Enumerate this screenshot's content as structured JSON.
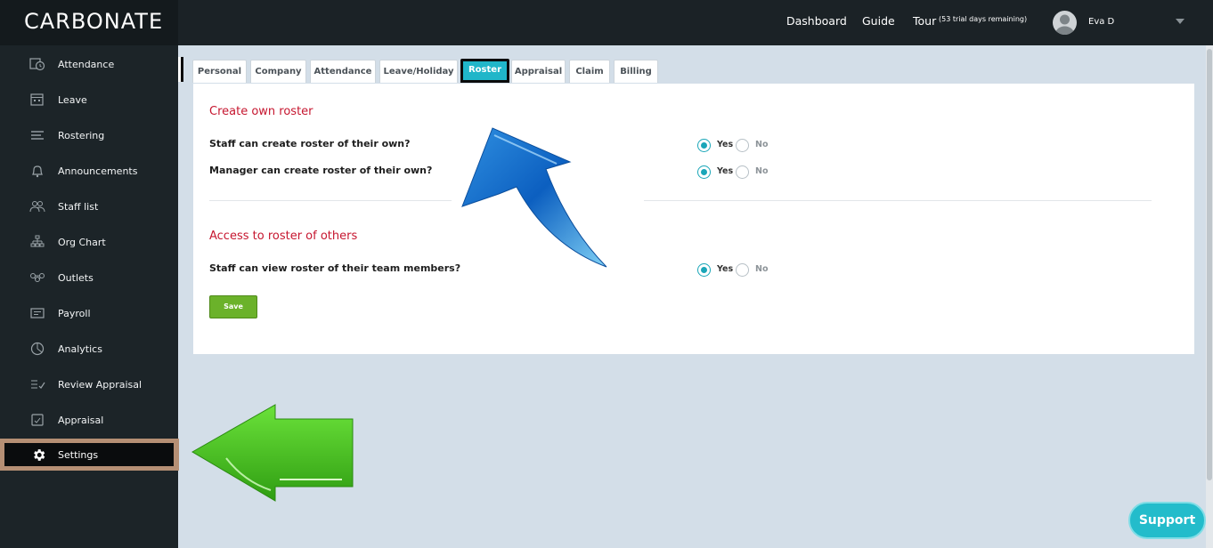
{
  "app": {
    "logo": "CARBONATE",
    "nav": {
      "dashboard": "Dashboard",
      "guide": "Guide",
      "tour": "Tour",
      "trial_note": "(53 trial days remaining)"
    },
    "user": {
      "name": "Eva D"
    }
  },
  "sidebar": {
    "items": [
      {
        "label": "Attendance",
        "icon": "attendance-icon"
      },
      {
        "label": "Leave",
        "icon": "calendar-icon"
      },
      {
        "label": "Rostering",
        "icon": "roster-icon"
      },
      {
        "label": "Announcements",
        "icon": "bell-icon"
      },
      {
        "label": "Staff list",
        "icon": "people-icon"
      },
      {
        "label": "Org Chart",
        "icon": "org-chart-icon"
      },
      {
        "label": "Outlets",
        "icon": "outlets-icon"
      },
      {
        "label": "Payroll",
        "icon": "payroll-icon"
      },
      {
        "label": "Analytics",
        "icon": "analytics-icon"
      },
      {
        "label": "Review Appraisal",
        "icon": "review-icon"
      },
      {
        "label": "Appraisal",
        "icon": "appraisal-icon"
      },
      {
        "label": "Settings",
        "icon": "gear-icon"
      }
    ],
    "active": "Settings"
  },
  "tabs": {
    "items": [
      "Personal",
      "Company",
      "Attendance",
      "Leave/Holiday",
      "Roster",
      "Appraisal",
      "Claim",
      "Billing"
    ],
    "active": "Roster"
  },
  "panel": {
    "section1_title": "Create own roster",
    "section2_title": "Access to roster of others",
    "questions": [
      {
        "label": "Staff can create roster of their own?",
        "yes": "Yes",
        "no": "No",
        "selected": "Yes"
      },
      {
        "label": "Manager can create roster of their own?",
        "yes": "Yes",
        "no": "No",
        "selected": "Yes"
      },
      {
        "label": "Staff can view roster of their team members?",
        "yes": "Yes",
        "no": "No",
        "selected": "Yes"
      }
    ],
    "save_label": "Save"
  },
  "support_label": "Support",
  "colors": {
    "accent": "#20b6c9",
    "section_title": "#c6162f",
    "save_button": "#6bb22a",
    "sidebar_bg": "#1c2428",
    "page_bg": "#d3dee8"
  }
}
